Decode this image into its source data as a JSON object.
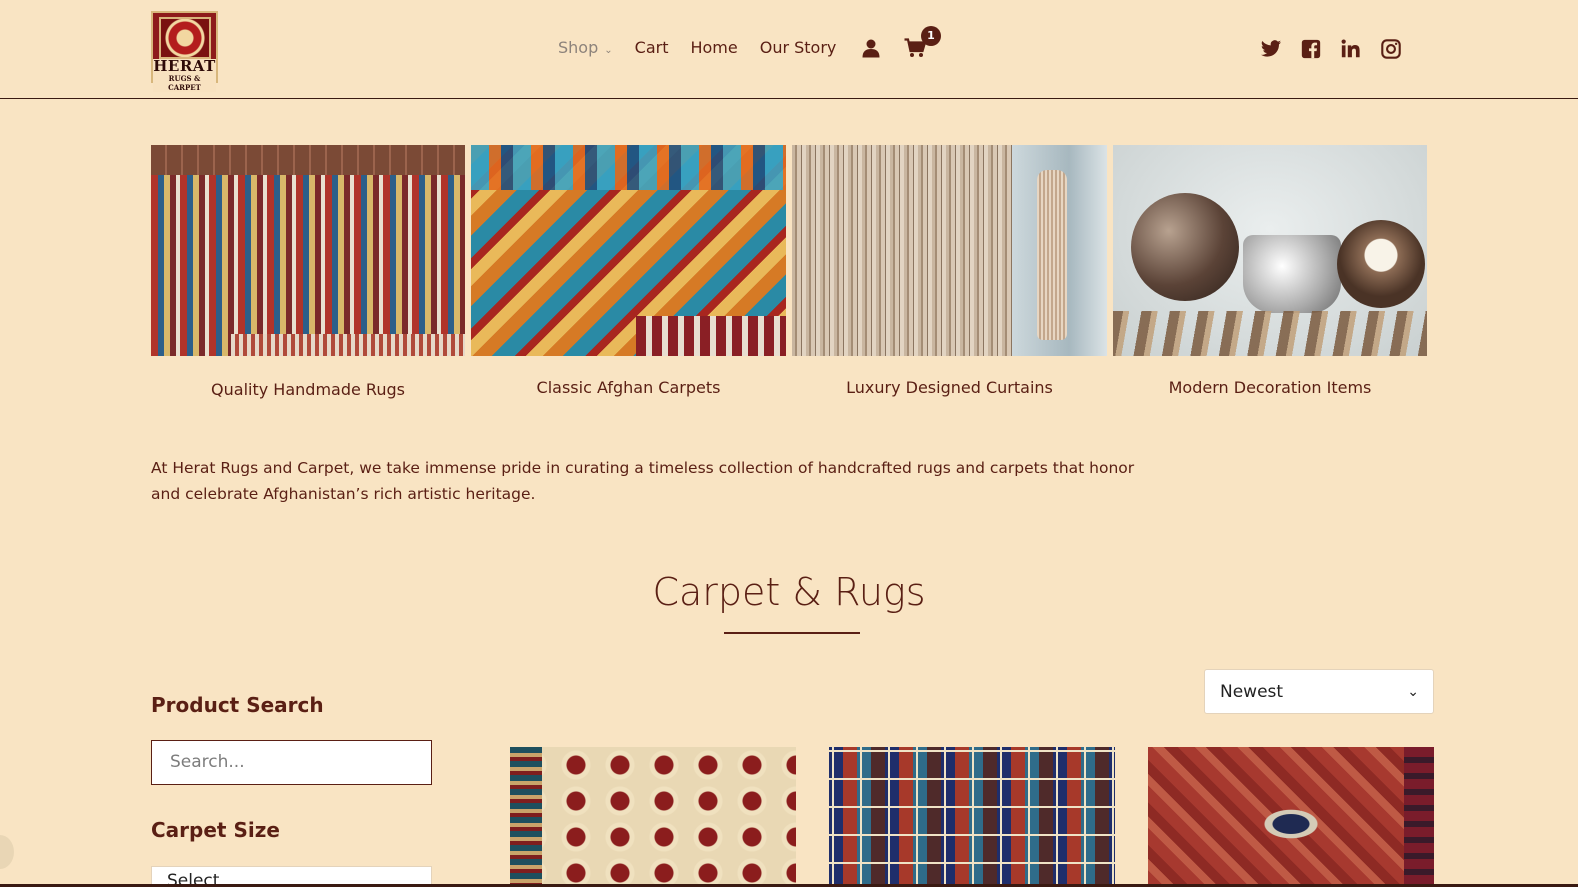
{
  "logo": {
    "line1": "HERAT",
    "line2": "RUGS & CARPET"
  },
  "nav": {
    "items": [
      "Shop",
      "Cart",
      "Home",
      "Our Story"
    ],
    "shop_chevron": "⌄",
    "account_icon": "user-icon",
    "cart_icon": "cart-icon",
    "cart_count": "1"
  },
  "social": [
    "twitter-icon",
    "facebook-icon",
    "linkedin-icon",
    "instagram-icon"
  ],
  "categories": [
    {
      "label": "Quality Handmade Rugs"
    },
    {
      "label": "Classic Afghan Carpets"
    },
    {
      "label": "Luxury Designed Curtains"
    },
    {
      "label": "Modern Decoration Items"
    }
  ],
  "intro": "At Herat Rugs and Carpet, we take immense pride in curating a timeless collection of handcrafted rugs and carpets that honor and celebrate Afghanistan’s rich artistic heritage.",
  "section": {
    "title": "Carpet & Rugs"
  },
  "sort": {
    "selected": "Newest",
    "caret": "⌄"
  },
  "sidebar": {
    "search_title": "Product Search",
    "search_placeholder": "Search...",
    "size_title": "Carpet Size",
    "size_selected": "Select"
  },
  "colors": {
    "background": "#f9e4c3",
    "text": "#5a1f14",
    "accent": "#5a1f14"
  }
}
